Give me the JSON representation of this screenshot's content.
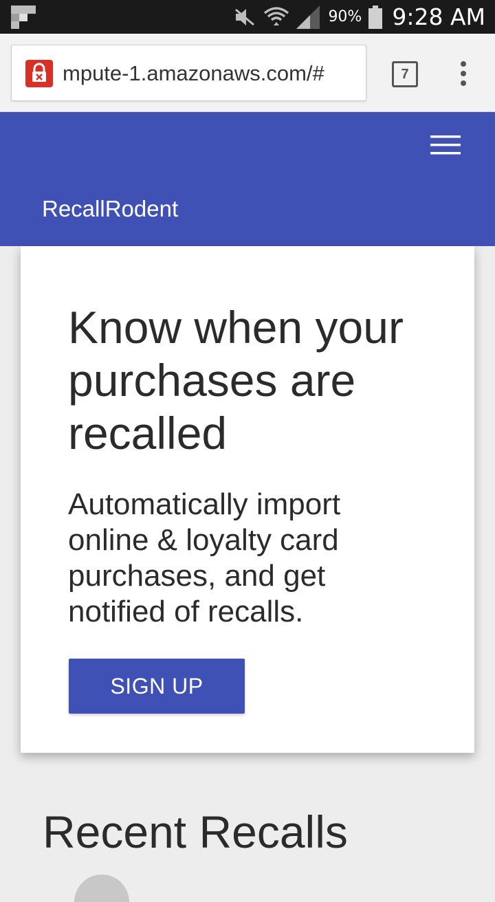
{
  "status_bar": {
    "battery": "90%",
    "time": "9:28 AM",
    "icons": [
      "flipboard-icon",
      "mute-icon",
      "wifi-icon",
      "signal-icon",
      "battery-icon"
    ]
  },
  "browser": {
    "url": "mpute-1.amazonaws.com/#",
    "tab_count": "7",
    "icons": [
      "insecure-lock-icon",
      "tab-switcher-icon",
      "more-vert-icon"
    ]
  },
  "app": {
    "brand": "RecallRodent",
    "header_color": "#3f51b5",
    "menu_icon": "hamburger-menu-icon"
  },
  "hero": {
    "title": "Know when your purchases are recalled",
    "subtitle": "Automatically import online & loyalty card purchases, and get notified of recalls.",
    "cta_label": "SIGN UP"
  },
  "recent": {
    "title": "Recent Recalls"
  }
}
